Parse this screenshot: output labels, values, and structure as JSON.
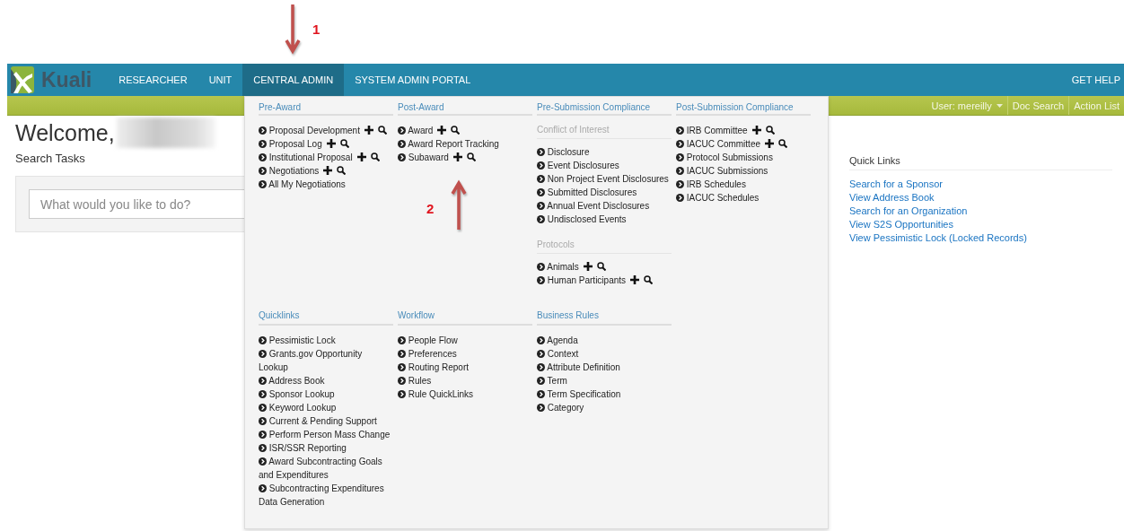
{
  "annotations": [
    {
      "label": "1"
    },
    {
      "label": "2"
    }
  ],
  "logo": {
    "text": "Kuali"
  },
  "nav": {
    "tabs": [
      {
        "label": "RESEARCHER",
        "selected": false
      },
      {
        "label": "UNIT",
        "selected": false
      },
      {
        "label": "CENTRAL ADMIN",
        "selected": true
      },
      {
        "label": "SYSTEM ADMIN PORTAL",
        "selected": false
      }
    ],
    "help": "GET HELP"
  },
  "user_bar": {
    "user": "User: mereilly",
    "links": [
      "Doc Search",
      "Action List"
    ]
  },
  "welcome": {
    "title": "Welcome,"
  },
  "search_tasks": {
    "title": "Search Tasks",
    "placeholder": "What would you like to do?"
  },
  "quick_links": {
    "title": "Quick Links",
    "links": [
      "Search for a Sponsor",
      "View Address Book",
      "Search for an Organization",
      "View S2S Opportunities",
      "View Pessimistic Lock (Locked Records)"
    ]
  },
  "menu": {
    "rows": [
      [
        {
          "title": "Pre-Award",
          "groups": [
            {
              "items": [
                {
                  "label": "Proposal Development",
                  "kind": "actions"
                },
                {
                  "label": "Proposal Log",
                  "kind": "actions"
                },
                {
                  "label": "Institutional Proposal",
                  "kind": "actions"
                },
                {
                  "label": "Negotiations",
                  "kind": "actions"
                },
                {
                  "label": "All My Negotiations",
                  "kind": "plain"
                }
              ]
            }
          ]
        },
        {
          "title": "Post-Award",
          "groups": [
            {
              "items": [
                {
                  "label": "Award",
                  "kind": "actions"
                },
                {
                  "label": "Award Report Tracking",
                  "kind": "plain"
                },
                {
                  "label": "Subaward",
                  "kind": "actions"
                }
              ]
            }
          ]
        },
        {
          "title": "Pre-Submission Compliance",
          "groups": [
            {
              "title": "Conflict of Interest",
              "items": [
                {
                  "label": "Disclosure",
                  "kind": "plain"
                },
                {
                  "label": "Event Disclosures",
                  "kind": "plain"
                },
                {
                  "label": "Non Project Event Disclosures",
                  "kind": "plain"
                },
                {
                  "label": "Submitted Disclosures",
                  "kind": "plain"
                },
                {
                  "label": "Annual Event Disclosures",
                  "kind": "plain"
                },
                {
                  "label": "Undisclosed Events",
                  "kind": "plain"
                }
              ]
            },
            {
              "title": "Protocols",
              "items": [
                {
                  "label": "Animals",
                  "kind": "actions"
                },
                {
                  "label": "Human Participants",
                  "kind": "actions"
                }
              ]
            }
          ]
        },
        {
          "title": "Post-Submission Compliance",
          "groups": [
            {
              "items": [
                {
                  "label": "IRB Committee",
                  "kind": "actions"
                },
                {
                  "label": "IACUC Committee",
                  "kind": "actions"
                },
                {
                  "label": "Protocol Submissions",
                  "kind": "plain"
                },
                {
                  "label": "IACUC Submissions",
                  "kind": "plain"
                },
                {
                  "label": "IRB Schedules",
                  "kind": "plain"
                },
                {
                  "label": "IACUC Schedules",
                  "kind": "plain"
                }
              ]
            }
          ]
        }
      ],
      [
        {
          "title": "Quicklinks",
          "groups": [
            {
              "items": [
                {
                  "label": "Pessimistic Lock",
                  "kind": "plain"
                },
                {
                  "label": "Grants.gov Opportunity Lookup",
                  "kind": "plain"
                },
                {
                  "label": "Address Book",
                  "kind": "plain"
                },
                {
                  "label": "Sponsor Lookup",
                  "kind": "plain"
                },
                {
                  "label": "Keyword Lookup",
                  "kind": "plain"
                },
                {
                  "label": "Current & Pending Support",
                  "kind": "plain"
                },
                {
                  "label": "Perform Person Mass Change",
                  "kind": "plain"
                },
                {
                  "label": "ISR/SSR Reporting",
                  "kind": "plain"
                },
                {
                  "label": "Award Subcontracting Goals and Expenditures",
                  "kind": "plain"
                },
                {
                  "label": "Subcontracting Expenditures Data Generation",
                  "kind": "plain"
                }
              ]
            }
          ]
        },
        {
          "title": "Workflow",
          "groups": [
            {
              "items": [
                {
                  "label": "People Flow",
                  "kind": "plain"
                },
                {
                  "label": "Preferences",
                  "kind": "plain"
                },
                {
                  "label": "Routing Report",
                  "kind": "plain"
                },
                {
                  "label": "Rules",
                  "kind": "plain"
                },
                {
                  "label": "Rule QuickLinks",
                  "kind": "plain"
                }
              ]
            }
          ]
        },
        {
          "title": "Business Rules",
          "groups": [
            {
              "items": [
                {
                  "label": "Agenda",
                  "kind": "plain"
                },
                {
                  "label": "Context",
                  "kind": "plain"
                },
                {
                  "label": "Attribute Definition",
                  "kind": "plain"
                },
                {
                  "label": "Term",
                  "kind": "plain"
                },
                {
                  "label": "Term Specification",
                  "kind": "plain"
                },
                {
                  "label": "Category",
                  "kind": "plain"
                }
              ]
            }
          ]
        }
      ]
    ]
  }
}
